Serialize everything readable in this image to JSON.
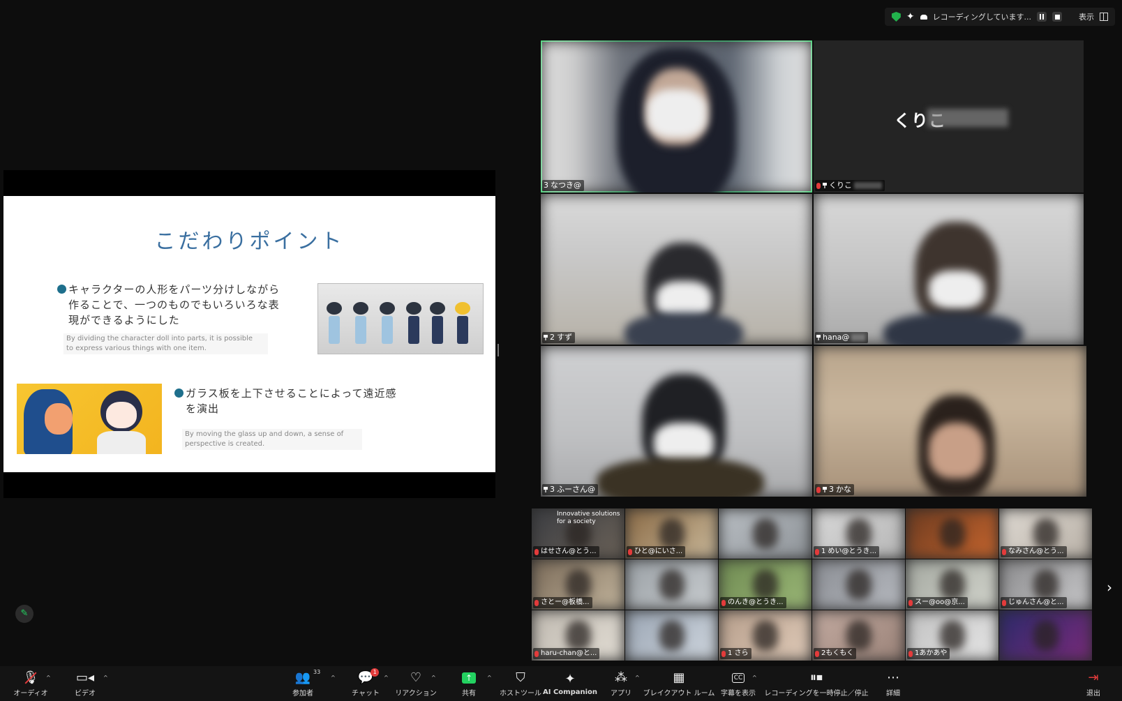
{
  "top_status": {
    "recording_text": "レコーディングしています...",
    "view_label": "表示"
  },
  "slide": {
    "title": "こだわりポイント",
    "point1_jp_lines": [
      "キャラクターの人形をパーツ分けしながら",
      "作ることで、一つのものでもいろいろな表",
      "現ができるようにした"
    ],
    "point1_en_lines": [
      "By dividing the character doll into parts, it is possible",
      "to express various things with one item."
    ],
    "point2_jp_lines": [
      "ガラス板を上下させることによって遠近感",
      "を演出"
    ],
    "point2_en_lines": [
      "By moving the glass up and down, a sense of",
      "perspective is created."
    ]
  },
  "main_tiles": [
    {
      "label": "なつき@",
      "prefix": "3"
    },
    {
      "label": "くりこ",
      "prefix": ""
    },
    {
      "label": "すず",
      "prefix": "2"
    },
    {
      "label": "hana@",
      "prefix": ""
    },
    {
      "label": "ふーさん@",
      "prefix": "3"
    },
    {
      "label": "かな",
      "prefix": "3"
    }
  ],
  "name_tile_text": "くりこ",
  "thumb_tiles": [
    {
      "label": "はせさん@とう..."
    },
    {
      "label": "ひと@にいさ..."
    },
    {
      "label": ""
    },
    {
      "label": "1 めい@とうき..."
    },
    {
      "label": ""
    },
    {
      "label": "なみさん@とう..."
    },
    {
      "label": "さとー@板橋..."
    },
    {
      "label": ""
    },
    {
      "label": "のんき@とうき..."
    },
    {
      "label": ""
    },
    {
      "label": "スー@oo@京..."
    },
    {
      "label": "じゅんさん@と..."
    },
    {
      "label": "haru-chan@と..."
    },
    {
      "label": ""
    },
    {
      "label": "1 さら"
    },
    {
      "label": "2もくもく"
    },
    {
      "label": "1あかあや"
    },
    {
      "label": ""
    }
  ],
  "thumb_overlay_text": [
    "Innovative solutions",
    "for a society"
  ],
  "toolbar": {
    "audio": "オーディオ",
    "video": "ビデオ",
    "participants": "参加者",
    "participants_count": "33",
    "chat": "チャット",
    "chat_badge": "1",
    "reactions": "リアクション",
    "share": "共有",
    "host_tools": "ホストツール",
    "ai_companion": "AI Companion",
    "apps": "アプリ",
    "breakout": "ブレイクアウト ルーム",
    "captions": "字幕を表示",
    "recording": "レコーディングを一時停止／停止",
    "more": "詳細",
    "leave": "退出"
  },
  "colors": {
    "active_speaker": "#23d160",
    "slide_title": "#3a6fa0",
    "share_green": "#23d160",
    "mic_muted_red": "#e23b3b"
  }
}
